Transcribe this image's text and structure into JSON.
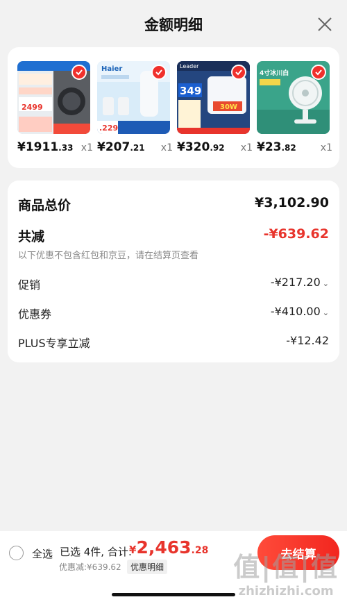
{
  "header": {
    "title": "金额明细"
  },
  "products": [
    {
      "price_int": "¥1911",
      "price_dec": ".33",
      "qty": "x1",
      "thumb_text": "2499",
      "thumb_bg": "#d7dde3"
    },
    {
      "price_int": "¥207",
      "price_dec": ".21",
      "qty": "x1",
      "thumb_text": "Haier",
      "thumb_bg": "#4a90d9"
    },
    {
      "price_int": "¥320",
      "price_dec": ".92",
      "qty": "x1",
      "thumb_text": "349",
      "thumb_bg": "#2a4f8f"
    },
    {
      "price_int": "¥23",
      "price_dec": ".82",
      "qty": "x1",
      "thumb_text": "4寸冰川白",
      "thumb_bg": "#3aa48a"
    }
  ],
  "summary": {
    "goods_total_label": "商品总价",
    "goods_total_value": "¥3,102.90",
    "reduce_label": "共减",
    "reduce_value": "-¥639.62",
    "note": "以下优惠不包含红包和京豆，请在结算页查看",
    "items": [
      {
        "label": "促销",
        "value": "-¥217.20",
        "expandable": true
      },
      {
        "label": "优惠券",
        "value": "-¥410.00",
        "expandable": true
      },
      {
        "label": "PLUS专享立减",
        "value": "-¥12.42",
        "expandable": false
      }
    ]
  },
  "footer": {
    "select_all": "全选",
    "selected_text": "已选 4件, 合计:",
    "total_currency": "¥",
    "total_int": "2,463",
    "total_dec": ".28",
    "discount_text": "优惠减:¥639.62",
    "discount_detail_button": "优惠明细",
    "checkout_button": "去结算"
  },
  "watermark": {
    "cn": "值|值|值",
    "en": "zhizhizhi.com"
  },
  "colors": {
    "accent": "#e8342c",
    "background": "#f2f2f2",
    "card": "#ffffff"
  }
}
